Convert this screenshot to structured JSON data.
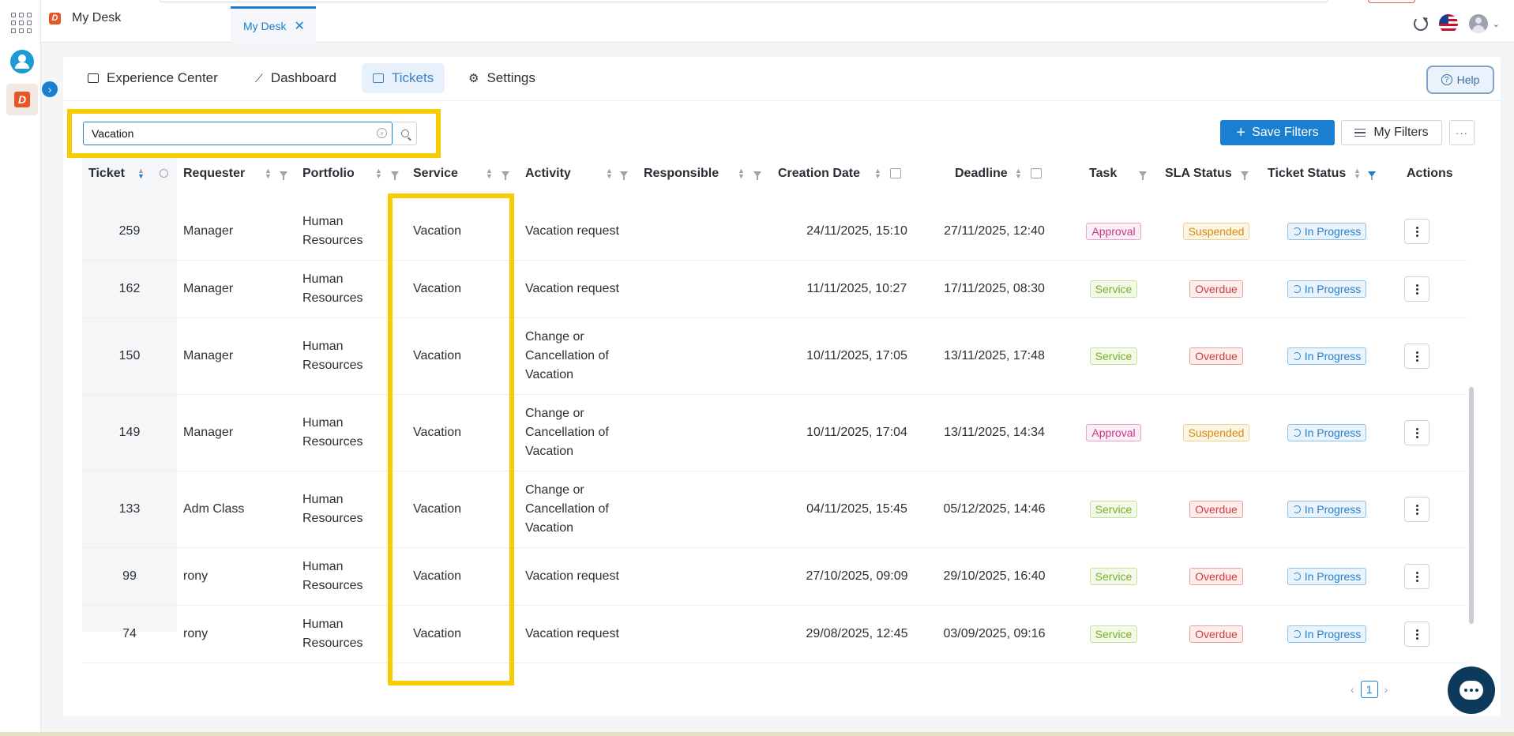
{
  "window": {
    "home_title": "My Desk",
    "active_tab": "My Desk",
    "close_glyph": "✕"
  },
  "rail": {
    "icons": [
      "apps-grid-icon",
      "user-icon",
      "desk-app-icon"
    ]
  },
  "nav": {
    "items": [
      {
        "label": "Experience Center",
        "icon": "laptop-icon"
      },
      {
        "label": "Dashboard",
        "icon": "chart-icon"
      },
      {
        "label": "Tickets",
        "icon": "ticket-icon",
        "active": true
      },
      {
        "label": "Settings",
        "icon": "gear-icon"
      }
    ],
    "help_label": "Help"
  },
  "search": {
    "value": "Vacation"
  },
  "toolbar": {
    "save_filters": "Save Filters",
    "my_filters": "My Filters",
    "more": "···"
  },
  "columns": [
    "Ticket",
    "Requester",
    "Portfolio",
    "Service",
    "Activity",
    "Responsible",
    "Creation Date",
    "Deadline",
    "Task",
    "SLA Status",
    "Ticket Status",
    "Actions"
  ],
  "rows": [
    {
      "ticket": "259",
      "requester": "Manager",
      "portfolio": "Human Resources",
      "service": "Vacation",
      "activity": "Vacation request",
      "responsible": "",
      "created": "24/11/2025, 15:10",
      "deadline": "27/11/2025, 12:40",
      "task": "Approval",
      "sla": "Suspended",
      "status": "In Progress"
    },
    {
      "ticket": "162",
      "requester": "Manager",
      "portfolio": "Human Resources",
      "service": "Vacation",
      "activity": "Vacation request",
      "responsible": "",
      "created": "11/11/2025, 10:27",
      "deadline": "17/11/2025, 08:30",
      "task": "Service",
      "sla": "Overdue",
      "status": "In Progress"
    },
    {
      "ticket": "150",
      "requester": "Manager",
      "portfolio": "Human Resources",
      "service": "Vacation",
      "activity": "Change or Cancellation of Vacation",
      "responsible": "",
      "created": "10/11/2025, 17:05",
      "deadline": "13/11/2025, 17:48",
      "task": "Service",
      "sla": "Overdue",
      "status": "In Progress"
    },
    {
      "ticket": "149",
      "requester": "Manager",
      "portfolio": "Human Resources",
      "service": "Vacation",
      "activity": "Change or Cancellation of Vacation",
      "responsible": "",
      "created": "10/11/2025, 17:04",
      "deadline": "13/11/2025, 14:34",
      "task": "Approval",
      "sla": "Suspended",
      "status": "In Progress"
    },
    {
      "ticket": "133",
      "requester": "Adm Class",
      "portfolio": "Human Resources",
      "service": "Vacation",
      "activity": "Change or Cancellation of Vacation",
      "responsible": "",
      "created": "04/11/2025, 15:45",
      "deadline": "05/12/2025, 14:46",
      "task": "Service",
      "sla": "Overdue",
      "status": "In Progress"
    },
    {
      "ticket": "99",
      "requester": "rony",
      "portfolio": "Human Resources",
      "service": "Vacation",
      "activity": "Vacation request",
      "responsible": "",
      "created": "27/10/2025, 09:09",
      "deadline": "29/10/2025, 16:40",
      "task": "Service",
      "sla": "Overdue",
      "status": "In Progress"
    },
    {
      "ticket": "74",
      "requester": "rony",
      "portfolio": "Human Resources",
      "service": "Vacation",
      "activity": "Vacation request",
      "responsible": "",
      "created": "29/08/2025, 12:45",
      "deadline": "03/09/2025, 09:16",
      "task": "Service",
      "sla": "Overdue",
      "status": "In Progress"
    }
  ],
  "pagination": {
    "current": "1",
    "prev": "‹",
    "next": "›"
  },
  "colors": {
    "accent": "#1a7fd0",
    "highlight": "#f5cd00"
  }
}
